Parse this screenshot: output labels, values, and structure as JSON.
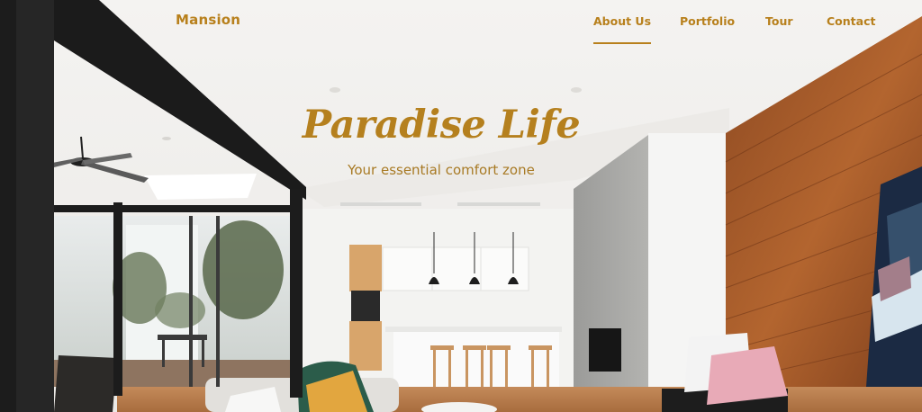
{
  "brand": {
    "name": "Mansion"
  },
  "nav": {
    "items": [
      {
        "label": "About Us",
        "active": true
      },
      {
        "label": "Portfolio",
        "active": false
      },
      {
        "label": "Tour",
        "active": false
      },
      {
        "label": "Contact",
        "active": false
      }
    ]
  },
  "hero": {
    "title": "Paradise Life",
    "subtitle": "Your essential comfort zone"
  },
  "colors": {
    "accent": "#b8801c",
    "wood_wall": "#a4582a",
    "ceiling": "#f2f1ef"
  }
}
